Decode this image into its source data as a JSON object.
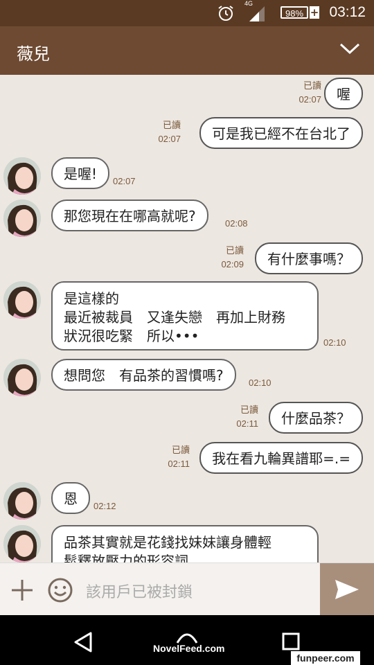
{
  "status": {
    "time": "03:12",
    "battery": "98%",
    "network": "4G"
  },
  "header": {
    "title": "薇兒"
  },
  "messages": [
    {
      "dir": "out",
      "text": "喔",
      "read": "已讀",
      "time": "02:07"
    },
    {
      "dir": "out",
      "text": "可是我已經不在台北了",
      "read": "已讀",
      "time": "02:07"
    },
    {
      "dir": "in",
      "text": "是喔!",
      "time": "02:07"
    },
    {
      "dir": "in",
      "text": "那您現在在哪高就呢?",
      "time": "02:08"
    },
    {
      "dir": "out",
      "text": "有什麼事嗎？",
      "read": "已讀",
      "time": "02:09"
    },
    {
      "dir": "in",
      "text": "是這樣的\n最近被裁員　又逢失戀　再加上財務\n狀況很吃緊　所以•••",
      "time": "02:10"
    },
    {
      "dir": "in",
      "text": "想問您　有品茶的習慣嗎?",
      "time": "02:10"
    },
    {
      "dir": "out",
      "text": "什麼品茶？",
      "read": "已讀",
      "time": "02:11"
    },
    {
      "dir": "out",
      "text": "我在看九輪異譜耶=.=",
      "read": "已讀",
      "time": "02:11"
    },
    {
      "dir": "in",
      "text": "恩",
      "time": "02:12"
    },
    {
      "dir": "in",
      "text": "品茶其實就是花錢找妹妹讓身體輕\n鬆釋放壓力的形容詞",
      "time": ""
    }
  ],
  "input": {
    "placeholder": "該用戶已被封鎖"
  },
  "navbar": {
    "watermark": "NovelFeed.com",
    "site": "funpeer.com"
  },
  "colors": {
    "statusbar": "#5a3a22",
    "header": "#6e4a32",
    "chat_bg": "#ede7e1",
    "send_bg": "#a88f7c"
  }
}
